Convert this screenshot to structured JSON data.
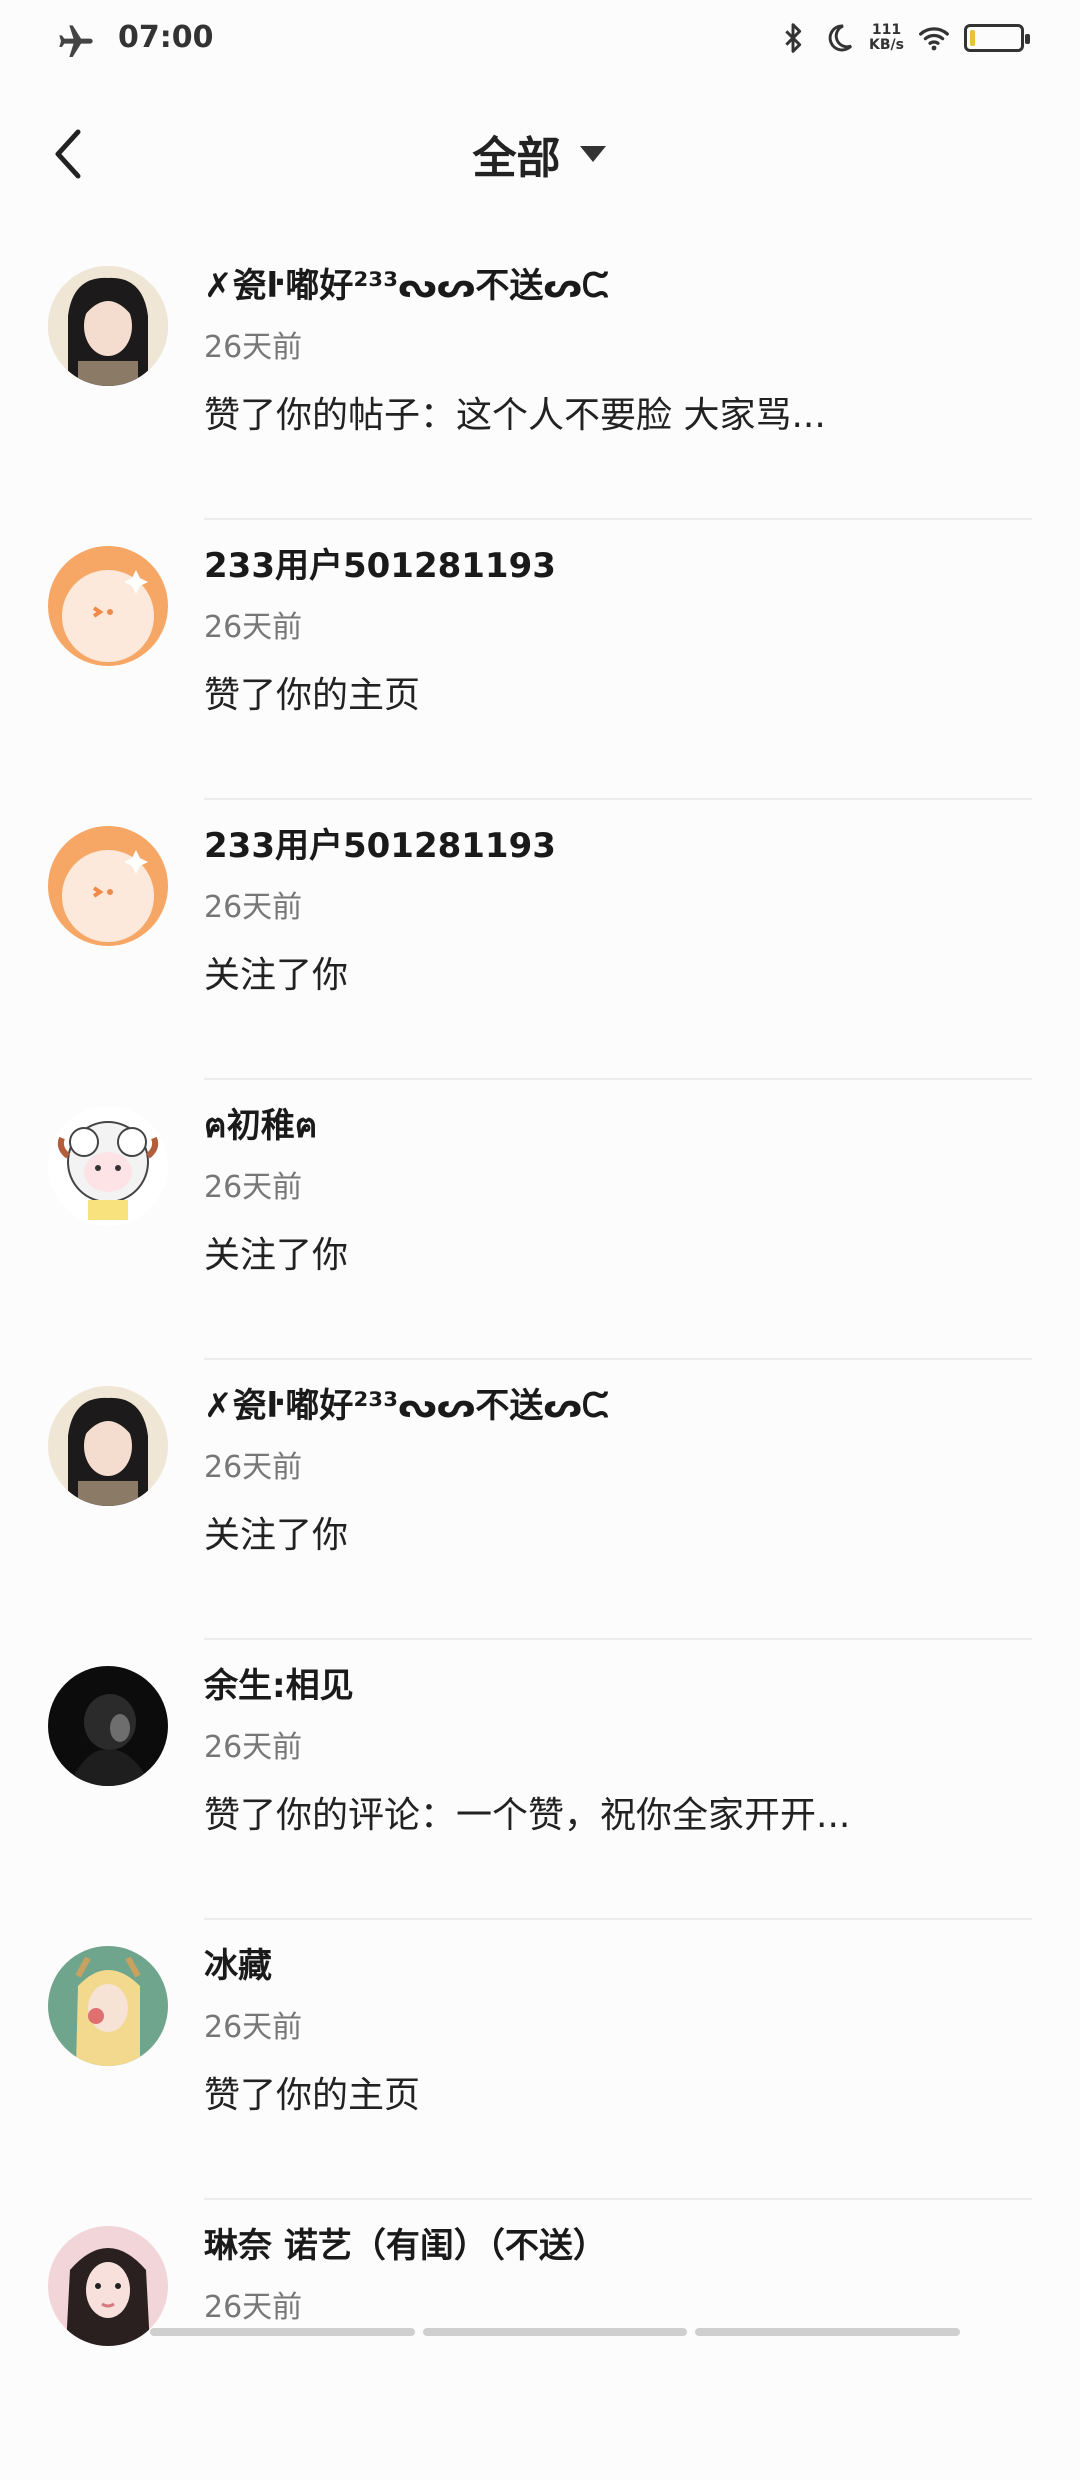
{
  "status_bar": {
    "time": "07:00",
    "speed_value": "111",
    "speed_unit": "KB/s",
    "icons": [
      "airplane-icon",
      "bluetooth-icon",
      "moon-icon",
      "wifi-icon",
      "battery-icon"
    ]
  },
  "header": {
    "title": "全部"
  },
  "notifications": [
    {
      "name": "✗瓷ŀ嘟好²³³ᔓᔕ不送ᔕᙅ",
      "time": "26天前",
      "action": "赞了你的帖子：这个人不要脸 大家骂...",
      "avatar": "girl-dark"
    },
    {
      "name": "233用户501281193",
      "time": "26天前",
      "action": "赞了你的主页",
      "avatar": "orange-default"
    },
    {
      "name": "233用户501281193",
      "time": "26天前",
      "action": "关注了你",
      "avatar": "orange-default"
    },
    {
      "name": "ฅ初稚ฅ",
      "time": "26天前",
      "action": "关注了你",
      "avatar": "sheep-cartoon"
    },
    {
      "name": "✗瓷ŀ嘟好²³³ᔓᔕ不送ᔕᙅ",
      "time": "26天前",
      "action": "关注了你",
      "avatar": "girl-dark"
    },
    {
      "name": "余生:相见",
      "time": "26天前",
      "action": "赞了你的评论：一个赞，祝你全家开开...",
      "avatar": "dark-photo"
    },
    {
      "name": "冰藏",
      "time": "26天前",
      "action": "赞了你的主页",
      "avatar": "anime-green"
    },
    {
      "name": "琳奈  诺艺（有闺）（不送）",
      "time": "26天前",
      "action": "",
      "avatar": "girl-pink"
    }
  ],
  "colors": {
    "background": "#fcfcfc",
    "avatar_orange": "#f7a765"
  }
}
